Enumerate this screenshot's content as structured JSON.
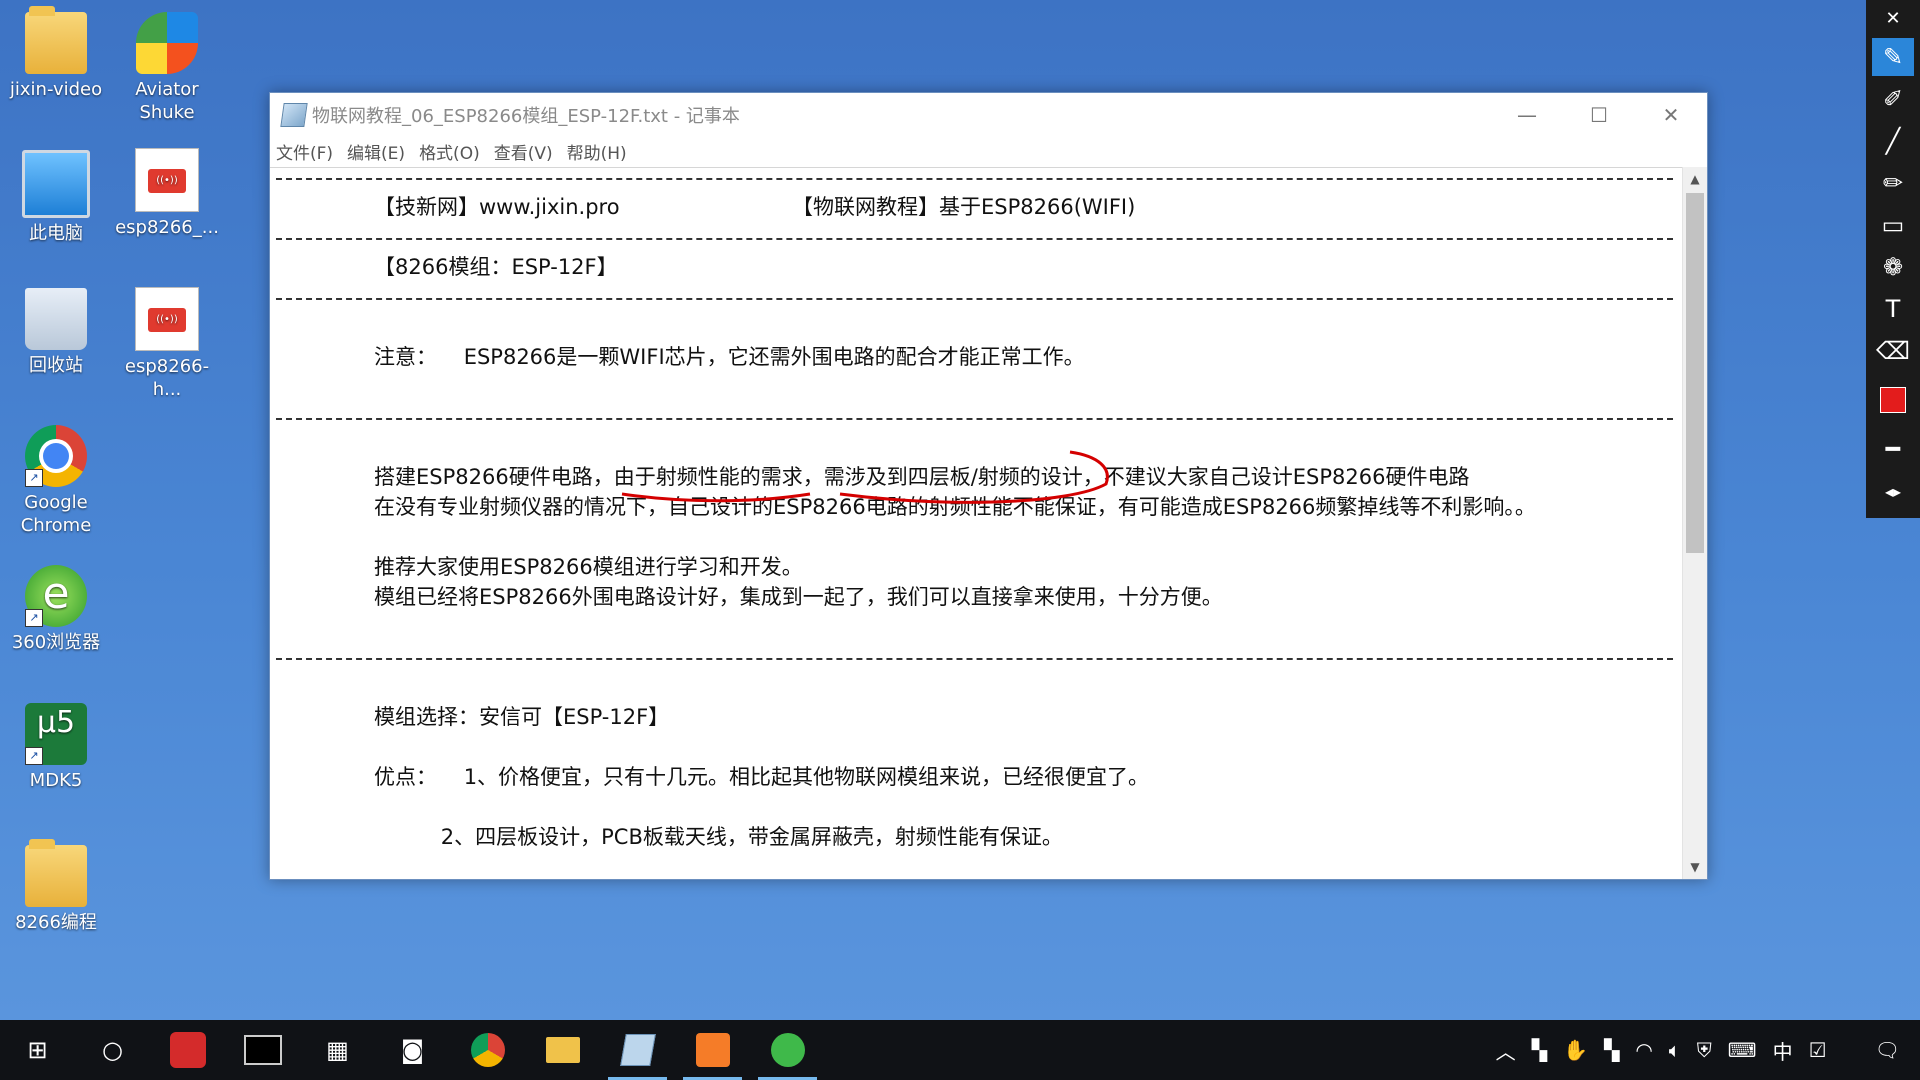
{
  "desktop_icons": [
    {
      "label": "jixin-video",
      "icon": "user-folder-icon"
    },
    {
      "label": "Aviator Shuke",
      "icon": "aviator-icon"
    },
    {
      "label": "此电脑",
      "icon": "computer-icon"
    },
    {
      "label": "esp8266_...",
      "icon": "pdf-document-icon"
    },
    {
      "label": "回收站",
      "icon": "recycle-bin-icon"
    },
    {
      "label": "esp8266-h...",
      "icon": "pdf-document-icon"
    },
    {
      "label": "Google Chrome",
      "icon": "chrome-icon"
    },
    {
      "label": "360浏览器",
      "icon": "360-browser-icon"
    },
    {
      "label": "MDK5",
      "icon": "keil-mdk-icon"
    },
    {
      "label": "8266编程",
      "icon": "folder-icon"
    }
  ],
  "notepad": {
    "title": "物联网教程_06_ESP8266模组_ESP-12F.txt - 记事本",
    "menu": [
      "文件(F)",
      "编辑(E)",
      "格式(O)",
      "查看(V)",
      "帮助(H)"
    ],
    "lines": {
      "l1a": "【技新网】www.jixin.pro",
      "l1b": "【物联网教程】基于ESP8266(WIFI)",
      "l2": "【8266模组：ESP-12F】",
      "l3": "注意：    ESP8266是一颗WIFI芯片，它还需外围电路的配合才能正常工作。",
      "l4": "搭建ESP8266硬件电路，由于射频性能的需求，需涉及到四层板/射频的设计，不建议大家自己设计ESP8266硬件电路",
      "l5": "在没有专业射频仪器的情况下，自己设计的ESP8266电路的射频性能不能保证，有可能造成ESP8266频繁掉线等不利影响。。",
      "l6": "推荐大家使用ESP8266模组进行学习和开发。",
      "l7": "模组已经将ESP8266外围电路设计好，集成到一起了，我们可以直接拿来使用，十分方便。",
      "l8": "模组选择：安信可【ESP-12F】",
      "l9": "优点：    1、价格便宜，只有十几元。相比起其他物联网模组来说，已经很便宜了。",
      "l10": "          2、四层板设计，PCB板载天线，带金属屏蔽壳，射频性能有保证。"
    }
  },
  "window_controls": {
    "minimize": "—",
    "maximize": "☐",
    "close": "✕"
  },
  "pen_tools": [
    "close-icon",
    "pen-icon",
    "marker-icon",
    "line-icon",
    "brush-icon",
    "rectangle-icon",
    "stamp-icon",
    "text-icon",
    "eraser-icon",
    "color-swatch-icon",
    "stroke-width-icon",
    "expand-icon"
  ],
  "pen_colors": {
    "active": "#e31c1c",
    "annotation": "#d40000"
  },
  "taskbar": {
    "apps": [
      "windows-start-icon",
      "search-circle-icon",
      "youdao-icon",
      "terminal-icon",
      "calculator-icon",
      "camera-icon",
      "chrome-icon",
      "file-explorer-icon",
      "notepad-icon",
      "pdf-reader-icon",
      "360-browser-icon"
    ],
    "tray_ime": "中"
  }
}
